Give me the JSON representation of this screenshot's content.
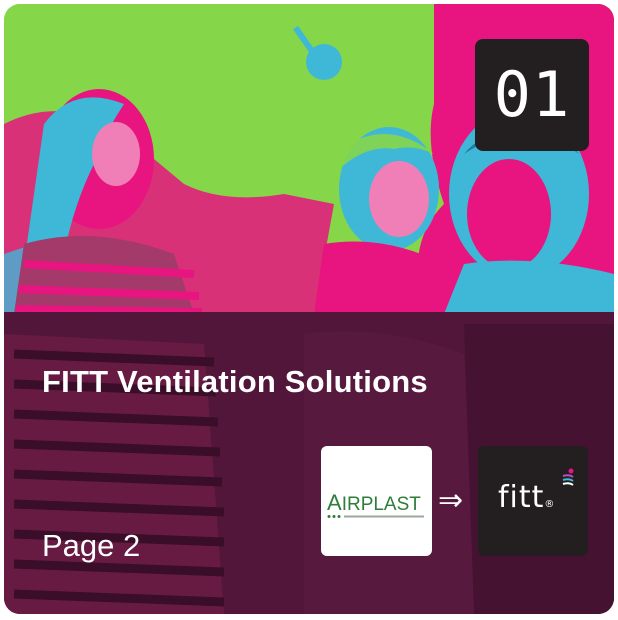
{
  "card": {
    "badge_number": "01",
    "title": "FITT Ventilation Solutions",
    "page_label": "Page 2"
  },
  "logos": {
    "airplast": {
      "name": "AIRPLAST",
      "first_letter": "A",
      "rest": "IRPLAST",
      "color": "#2e7d3a"
    },
    "arrow": "⇒",
    "fitt": {
      "name": "fitt",
      "reg_mark": "®"
    }
  },
  "colors": {
    "background_green": "#86d64a",
    "magenta": "#e8147f",
    "cyan": "#3fb8d8",
    "overlay": "#3a0e28",
    "badge": "#231f20"
  },
  "icons": {
    "arrow": "double-right-arrow-icon"
  }
}
